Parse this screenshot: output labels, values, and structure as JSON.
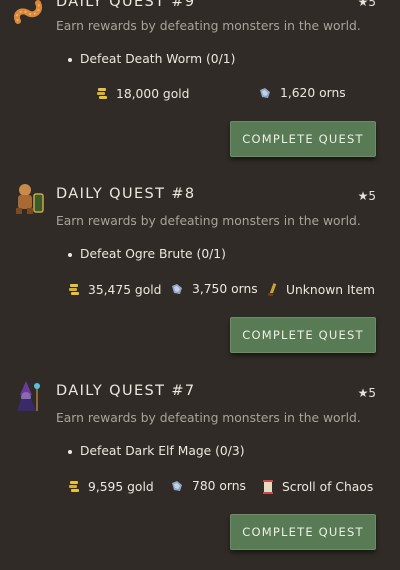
{
  "quests": [
    {
      "title": "DAILY QUEST #9",
      "stars": "★5",
      "description": "Earn rewards by defeating monsters in the world.",
      "objective": "Defeat Death Worm (0/1)",
      "rewards": [
        {
          "icon": "gold-coins-icon",
          "label": "18,000 gold"
        },
        {
          "icon": "orns-icon",
          "label": "1,620 orns"
        }
      ],
      "button": "COMPLETE QUEST"
    },
    {
      "title": "DAILY QUEST #8",
      "stars": "★5",
      "description": "Earn rewards by defeating monsters in the world.",
      "objective": "Defeat Ogre Brute (0/1)",
      "rewards": [
        {
          "icon": "gold-coins-icon",
          "label": "35,475 gold"
        },
        {
          "icon": "orns-icon",
          "label": "3,750 orns"
        },
        {
          "icon": "unknown-item-icon",
          "label": "Unknown Item"
        }
      ],
      "button": "COMPLETE QUEST"
    },
    {
      "title": "DAILY QUEST #7",
      "stars": "★5",
      "description": "Earn rewards by defeating monsters in the world.",
      "objective": "Defeat Dark Elf Mage (0/3)",
      "rewards": [
        {
          "icon": "gold-coins-icon",
          "label": "9,595 gold"
        },
        {
          "icon": "orns-icon",
          "label": "780 orns"
        },
        {
          "icon": "scroll-icon",
          "label": "Scroll of Chaos"
        }
      ],
      "button": "COMPLETE QUEST"
    }
  ],
  "colors": {
    "background": "#302b26",
    "button": "#587a54",
    "muted_text": "#a9a39a"
  }
}
